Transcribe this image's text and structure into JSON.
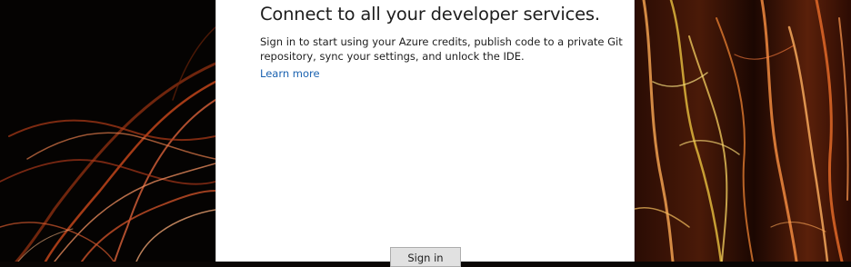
{
  "dialog": {
    "heading": "Connect to all your developer services.",
    "description": "Sign in to start using your Azure credits, publish code to a private Git repository, sync your settings, and unlock the IDE.",
    "learn_more": "Learn more",
    "sign_in_label": "Sign in"
  },
  "colors": {
    "link": "#1a62b0",
    "dialog_bg": "#ffffff",
    "button_bg": "#e1e1e1"
  }
}
